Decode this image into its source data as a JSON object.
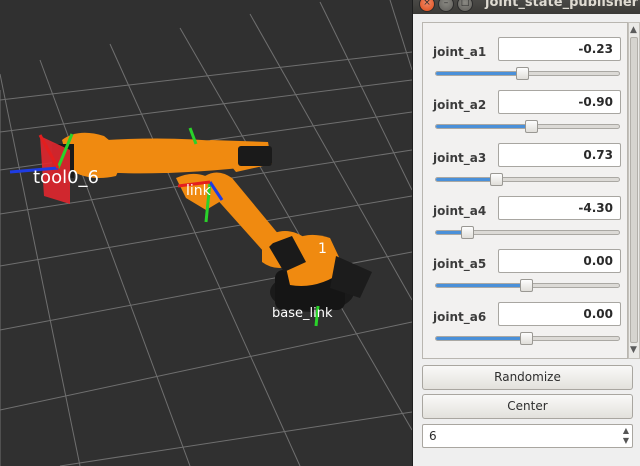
{
  "window": {
    "title": "joint_state_publisher",
    "close_glyph": "×",
    "minimize_glyph": "–",
    "maximize_glyph": "□"
  },
  "viewport": {
    "labels": {
      "tool": "tool0_6",
      "link_mid": "link",
      "link_base": "1",
      "base": "base_link"
    },
    "colors": {
      "background": "#303030",
      "grid": "#7a7a7a",
      "robot": "#f08a10",
      "axis_x": "#e41e1e",
      "axis_y": "#2ad22a",
      "axis_z": "#1e3ce4"
    }
  },
  "joints": [
    {
      "name": "joint_a1",
      "value": "-0.23",
      "slider_fraction": 0.47
    },
    {
      "name": "joint_a2",
      "value": "-0.90",
      "slider_fraction": 0.52
    },
    {
      "name": "joint_a3",
      "value": "0.73",
      "slider_fraction": 0.33
    },
    {
      "name": "joint_a4",
      "value": "-4.30",
      "slider_fraction": 0.17
    },
    {
      "name": "joint_a5",
      "value": "0.00",
      "slider_fraction": 0.49
    },
    {
      "name": "joint_a6",
      "value": "0.00",
      "slider_fraction": 0.49
    }
  ],
  "buttons": {
    "randomize": "Randomize",
    "center": "Center"
  },
  "spinbox": {
    "value": "6"
  },
  "icons": {
    "scroll_up": "▲",
    "scroll_down": "▼",
    "spin_up": "▲",
    "spin_down": "▼"
  },
  "accent_color": "#4a90d9"
}
